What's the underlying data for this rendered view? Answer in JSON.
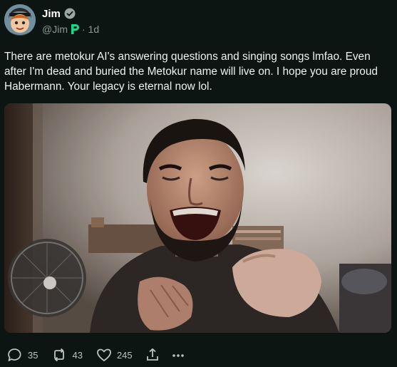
{
  "author": {
    "display_name": "Jim",
    "handle": "@Jim",
    "timestamp": "· 1d",
    "verified_icon": "verified-check-icon",
    "badge_icon": "poal-p-icon",
    "verified_color": "#1d9bf0",
    "badge_color": "#1fd38a"
  },
  "post": {
    "text": "There are metokur AI's answering questions and singing songs lmfao.  Even after I'm dead and buried the Metokur name will live on.  I hope you are proud Habermann.  Your legacy is eternal now lol."
  },
  "actions": {
    "replies": "35",
    "reposts": "43",
    "likes": "245",
    "share_icon": "share-icon",
    "more_icon": "more-dots-icon"
  },
  "colors": {
    "background": "#0d1512",
    "text": "#eef2f0",
    "muted": "#8b9a96"
  }
}
